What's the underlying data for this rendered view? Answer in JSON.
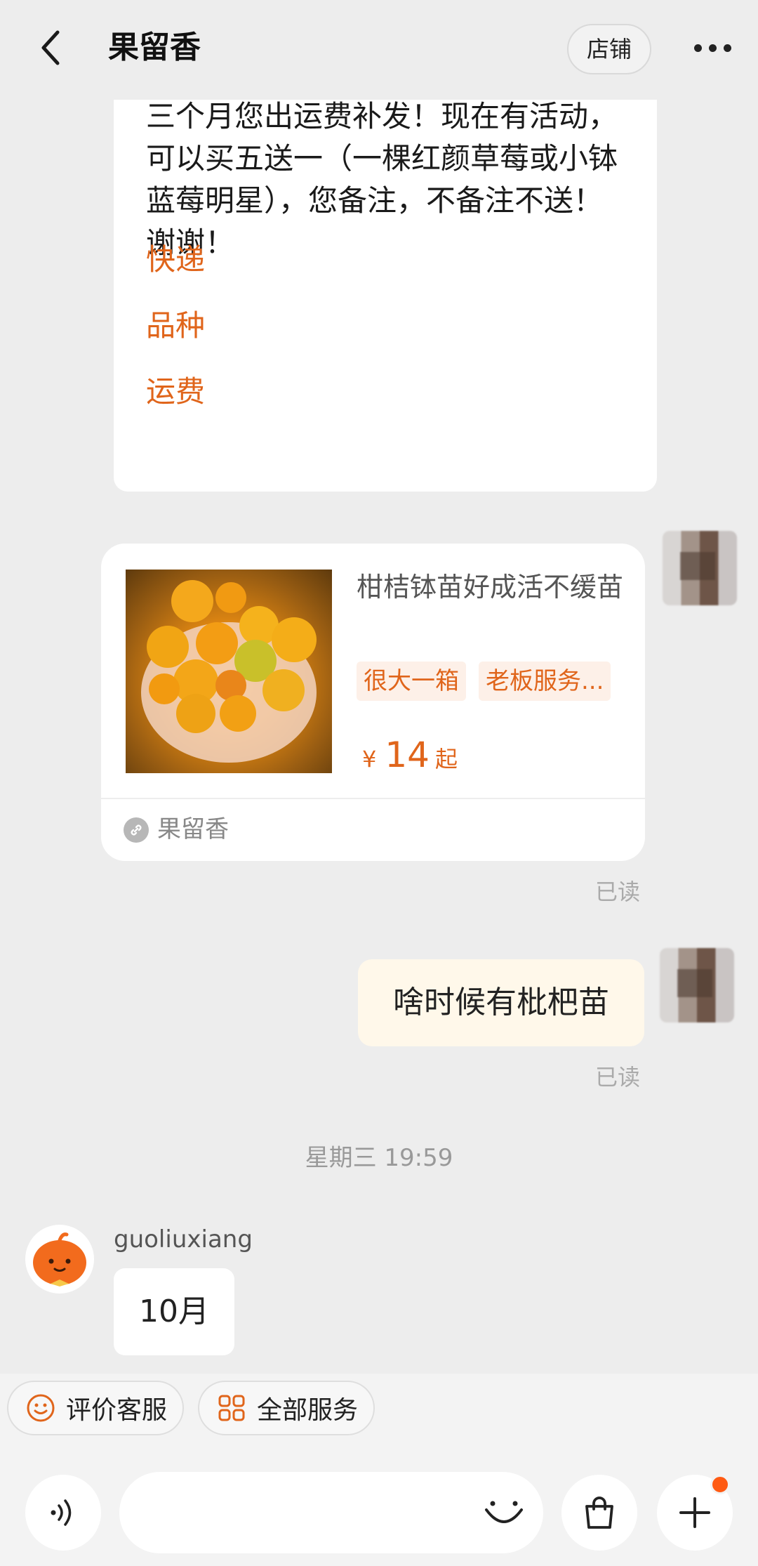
{
  "header": {
    "title": "果留香",
    "shop_label": "店铺"
  },
  "faq_message": {
    "text": "三个月您出运费补发！现在有活动，可以买五送一（一棵红颜草莓或小钵蓝莓明星），您备注，不备注不送！谢谢！",
    "links": [
      "快递",
      "品种",
      "运费"
    ]
  },
  "product_card": {
    "title": "柑桔钵苗好成活不缓苗",
    "tags": [
      "很大一箱",
      "老板服务..."
    ],
    "price_symbol": "¥",
    "price": "14",
    "price_suffix": "起",
    "shop_name": "果留香"
  },
  "user_message": {
    "text": "啥时候有枇杷苗"
  },
  "read_label": "已读",
  "timestamp": "星期三 19:59",
  "shop_reply": {
    "sender": "guoliuxiang",
    "text": "10月"
  },
  "quick_services": [
    "评价客服",
    "全部服务"
  ],
  "input": {
    "placeholder": ""
  },
  "colors": {
    "accent": "#e0651b",
    "background": "#ededed",
    "user_bubble": "#fff8ea",
    "badge": "#ff5a12"
  }
}
